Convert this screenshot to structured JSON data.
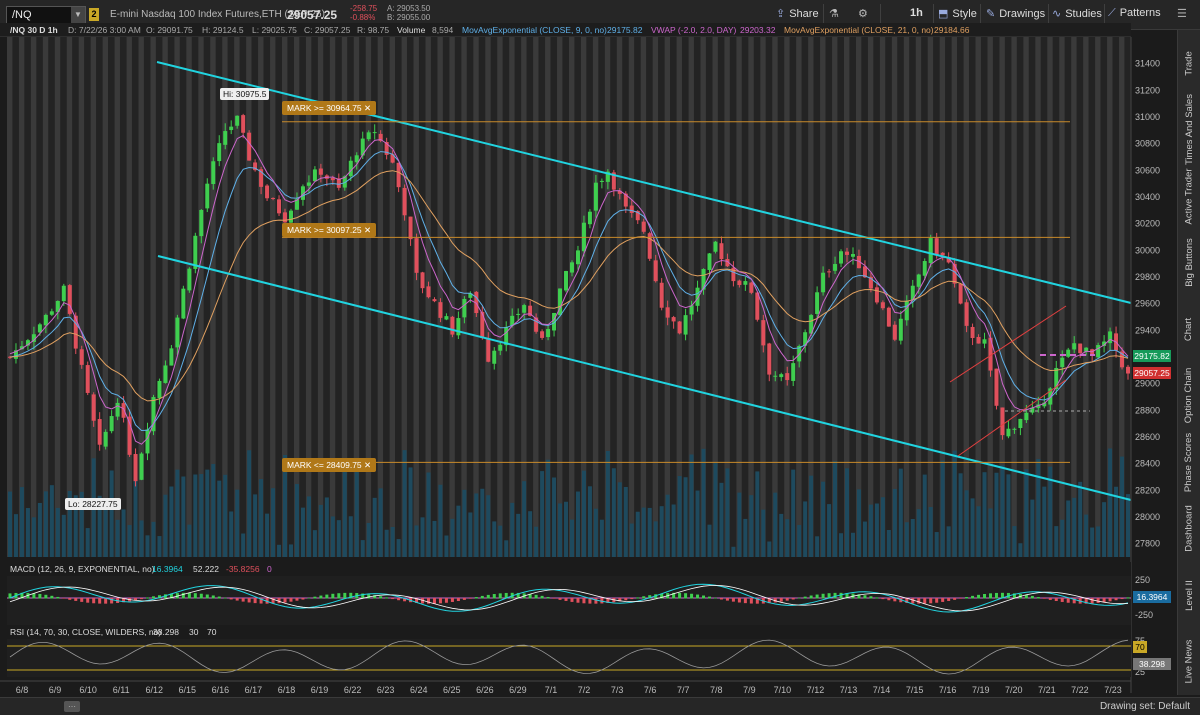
{
  "toolbar": {
    "symbol": "/NQ",
    "link_badge": "2",
    "description": "E-mini Nasdaq 100 Index Futures,ETH (SEP 26)",
    "last_price": "29057.25",
    "change_abs": "-258.75",
    "change_pct": "-0.88%",
    "bid": "A: 29053.50",
    "ask": "B: 29055.00",
    "share_label": "Share",
    "timeframe": "1h",
    "style_label": "Style",
    "drawings_label": "Drawings",
    "studies_label": "Studies",
    "patterns_label": "Patterns"
  },
  "info": {
    "title": "/NQ 30 D 1h",
    "date": "D: 7/22/26 3:00 AM",
    "open": "O: 29091.75",
    "high": "H: 29124.5",
    "low": "L: 29025.75",
    "close": "C: 29057.25",
    "range": "R: 98.75",
    "volume_label": "Volume",
    "volume": "8,594",
    "ema9_label": "MovAvgExponential (CLOSE, 9, 0, no)",
    "ema9_value": "29175.82",
    "vwap_label": "VWAP (-2.0, 2.0, DAY)",
    "vwap_value": "29203.32",
    "ema21_label": "MovAvgExponential (CLOSE, 21, 0, no)",
    "ema21_value": "29184.66"
  },
  "colors": {
    "up": "#3fcf4f",
    "down": "#e0505c",
    "ema9": "#5fb0e8",
    "vwap": "#cc66cc",
    "ema21": "#e0a060",
    "trend": "#21d4e0",
    "mark": "#c88a2a",
    "macd": "#21d4e0",
    "signal": "#ffffff"
  },
  "chart_data": {
    "type": "candlestick",
    "y_axis_ticks": [
      "31400",
      "31200",
      "31000",
      "30800",
      "30600",
      "30400",
      "30200",
      "30000",
      "29800",
      "29600",
      "29400",
      "29200",
      "29000",
      "28800",
      "28600",
      "28400",
      "28200",
      "28000",
      "27800"
    ],
    "ylim": [
      27700,
      31600
    ],
    "date_labels": [
      "6/8",
      "6/9",
      "6/10",
      "6/11",
      "6/12",
      "6/15",
      "6/16",
      "6/17",
      "6/18",
      "6/19",
      "6/22",
      "6/23",
      "6/24",
      "6/25",
      "6/26",
      "6/29",
      "7/1",
      "7/2",
      "7/3",
      "7/6",
      "7/7",
      "7/8",
      "7/9",
      "7/10",
      "7/12",
      "7/13",
      "7/14",
      "7/15",
      "7/16",
      "7/19",
      "7/20",
      "7/21",
      "7/22",
      "7/23"
    ],
    "close_path": [
      [
        0,
        29200
      ],
      [
        3,
        29350
      ],
      [
        6,
        29500
      ],
      [
        9,
        29700
      ],
      [
        12,
        29100
      ],
      [
        15,
        28500
      ],
      [
        18,
        28900
      ],
      [
        21,
        28300
      ],
      [
        24,
        28900
      ],
      [
        27,
        29300
      ],
      [
        30,
        29900
      ],
      [
        33,
        30500
      ],
      [
        36,
        30900
      ],
      [
        38,
        30975
      ],
      [
        40,
        30700
      ],
      [
        43,
        30400
      ],
      [
        46,
        30250
      ],
      [
        49,
        30500
      ],
      [
        52,
        30600
      ],
      [
        55,
        30450
      ],
      [
        58,
        30750
      ],
      [
        61,
        30900
      ],
      [
        64,
        30650
      ],
      [
        66,
        30300
      ],
      [
        68,
        29800
      ],
      [
        71,
        29600
      ],
      [
        74,
        29400
      ],
      [
        77,
        29700
      ],
      [
        80,
        29200
      ],
      [
        83,
        29400
      ],
      [
        86,
        29600
      ],
      [
        89,
        29300
      ],
      [
        92,
        29700
      ],
      [
        95,
        30000
      ],
      [
        98,
        30500
      ],
      [
        100,
        30600
      ],
      [
        103,
        30300
      ],
      [
        106,
        30150
      ],
      [
        109,
        29600
      ],
      [
        112,
        29400
      ],
      [
        115,
        29700
      ],
      [
        118,
        30050
      ],
      [
        121,
        29800
      ],
      [
        124,
        29700
      ],
      [
        127,
        29100
      ],
      [
        130,
        29000
      ],
      [
        133,
        29400
      ],
      [
        136,
        29800
      ],
      [
        139,
        30000
      ],
      [
        142,
        29900
      ],
      [
        145,
        29650
      ],
      [
        148,
        29350
      ],
      [
        151,
        29700
      ],
      [
        154,
        30050
      ],
      [
        157,
        29900
      ],
      [
        160,
        29400
      ],
      [
        163,
        29300
      ],
      [
        166,
        28600
      ],
      [
        169,
        28750
      ],
      [
        172,
        28800
      ],
      [
        175,
        29100
      ],
      [
        178,
        29300
      ],
      [
        181,
        29200
      ],
      [
        184,
        29350
      ],
      [
        187,
        29057
      ]
    ],
    "high": "30975.5",
    "low": "28227.75",
    "marks": [
      "MARK >= 30964.75",
      "MARK >= 30097.25",
      "MARK <= 28409.75"
    ],
    "mark_levels": [
      30964.75,
      30097.25,
      28409.75
    ],
    "price_tags": {
      "ema": "29175.82",
      "last": "29057.25"
    }
  },
  "macd": {
    "label": "MACD (12, 26, 9, EXPONENTIAL, no)",
    "value": "16.3964",
    "avg": "52.222",
    "diff": "-35.8256",
    "zero": "0",
    "ticks": [
      "250",
      "-250"
    ],
    "tag": "16.3964"
  },
  "rsi": {
    "label": "RSI (14, 70, 30, CLOSE, WILDERS, no)",
    "value": "38.298",
    "ob": "30",
    "os": "70",
    "ticks": [
      "75",
      "25"
    ],
    "tag_70": "70",
    "tag_val": "38.298"
  },
  "side_tabs": [
    "Trade",
    "Times And Sales",
    "Active Trader",
    "Big Buttons",
    "Chart",
    "Option Chain",
    "Phase Scores",
    "Dashboard",
    "Level II",
    "Live News"
  ],
  "status": {
    "drawing_set": "Drawing set: Default"
  }
}
